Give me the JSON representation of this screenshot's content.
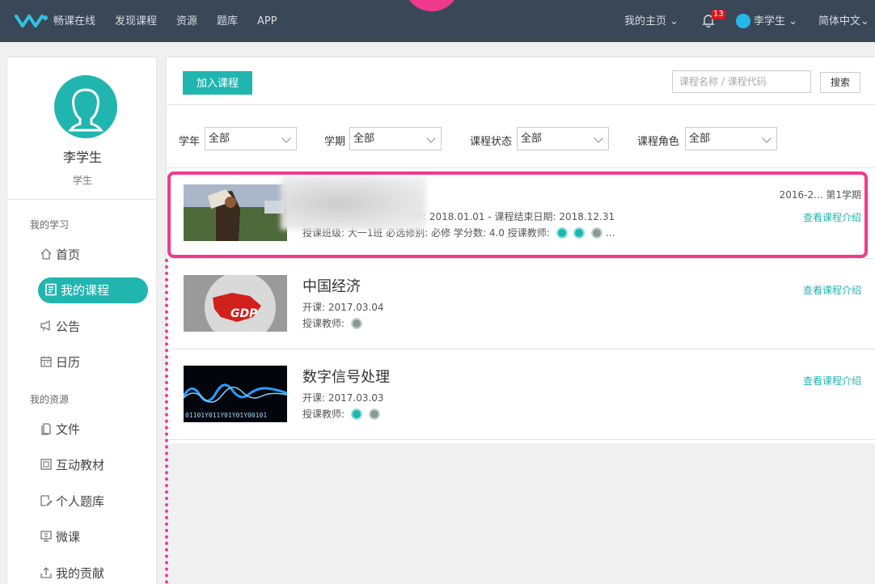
{
  "topnav": {
    "brand": "畅课在线",
    "links": [
      "发现课程",
      "资源",
      "题库",
      "APP"
    ],
    "my_home": "我的主页",
    "notification_count": "13",
    "user_name": "李学生",
    "language": "简体中文"
  },
  "sidebar": {
    "name": "李学生",
    "role": "学生",
    "section_learning": "我的学习",
    "learning_items": [
      "首页",
      "我的课程",
      "公告",
      "日历"
    ],
    "section_resources": "我的资源",
    "resource_items": [
      "文件",
      "互动教材",
      "个人题库",
      "微课",
      "我的贡献"
    ]
  },
  "toolbar": {
    "join_label": "加入课程",
    "search_placeholder": "课程名称 / 课程代码",
    "search_label": "搜索"
  },
  "filters": [
    {
      "label": "学年",
      "value": "全部"
    },
    {
      "label": "学期",
      "value": "全部"
    },
    {
      "label": "课程状态",
      "value": "全部"
    },
    {
      "label": "课程角色",
      "value": "全部"
    }
  ],
  "courses": [
    {
      "title": "",
      "dates": "期: 2018.01.01   -  课程结束日期: 2018.12.31",
      "details": "授课班级: 大一1班     必选修别: 必修     学分数: 4.0     授课教师:",
      "more": "...",
      "term": "2016-2...   第1学期",
      "link": "查看课程介绍"
    },
    {
      "title": "中国经济",
      "start": "开课: 2017.03.04",
      "teacher_label": "授课教师:",
      "link": "查看课程介绍",
      "thumb_text": "GDP"
    },
    {
      "title": "数字信号处理",
      "start": "开课: 2017.03.03",
      "teacher_label": "授课教师:",
      "link": "查看课程介绍",
      "thumb_text": "01101Y011Y01Y01Y00101"
    }
  ],
  "colors": {
    "accent": "#21b5b0",
    "highlight": "#ef3a8c",
    "nav_bg": "#3a4757"
  }
}
